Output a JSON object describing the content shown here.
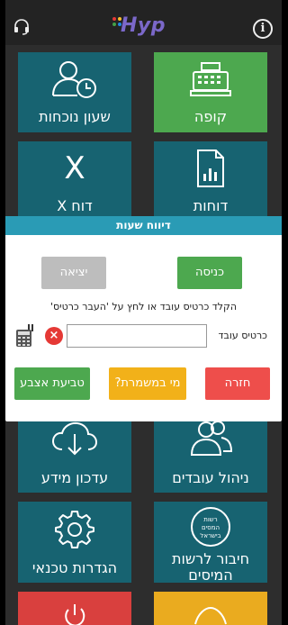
{
  "header": {
    "logo_text": "Hyp",
    "info_icon": "i"
  },
  "tiles": {
    "attendance": "שעון נוכחות",
    "cash_register": "קופה",
    "x_report": "דוח X",
    "x_report_glyph": "X",
    "reports": "דוחות",
    "update_info": "עדכון מידע",
    "employee_management": "ניהול עובדים",
    "tech_settings": "הגדרות טכנאי",
    "tax_authority_line1": "חיבור לרשות",
    "tax_authority_line2": "המיסים",
    "tax_logo_line1": "רשות",
    "tax_logo_line2": "המסים",
    "tax_logo_line3": "בישראל"
  },
  "dialog": {
    "title": "דיווח שעות",
    "entry_label": "כניסה",
    "exit_label": "יציאה",
    "instructions": "הקלד כרטיס עובד או לחץ על 'העבר כרטיס'",
    "card_label": "כרטיס עובד",
    "card_value": "",
    "card_placeholder": "",
    "clear_glyph": "×",
    "back_label": "חזרה",
    "on_shift_label": "מי במשמרת?",
    "fingerprint_label": "טביעת אצבע"
  },
  "colors": {
    "teal": "#176371",
    "green": "#4da84f",
    "red": "#ee4e4b",
    "yellow": "#f2b119",
    "header_bar": "#2a9bb5",
    "logo": "#7b68c9"
  }
}
